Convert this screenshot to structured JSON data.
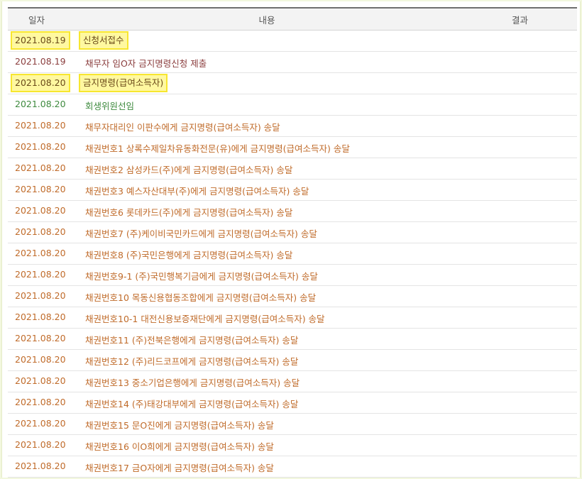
{
  "table": {
    "headers": {
      "date": "일자",
      "content": "내용",
      "result": "결과"
    },
    "rows": [
      {
        "date": "2021.08.19",
        "content": "신청서접수",
        "style": "hl"
      },
      {
        "date": "2021.08.19",
        "content": "채무자 임O자 금지명령신청 제출",
        "style": "c-dark"
      },
      {
        "date": "2021.08.20",
        "content": "금지명령(급여소득자)",
        "style": "hl"
      },
      {
        "date": "2021.08.20",
        "content": "회생위원선임",
        "style": "c-green"
      },
      {
        "date": "2021.08.20",
        "content": "채무자대리인 이판수에게 금지명령(급여소득자) 송달",
        "style": ""
      },
      {
        "date": "2021.08.20",
        "content": "채권번호1 상록수제일차유동화전문(유)에게 금지명령(급여소득자) 송달",
        "style": ""
      },
      {
        "date": "2021.08.20",
        "content": "채권번호2 삼성카드(주)에게 금지명령(급여소득자) 송달",
        "style": ""
      },
      {
        "date": "2021.08.20",
        "content": "채권번호3 예스자산대부(주)에게 금지명령(급여소득자) 송달",
        "style": ""
      },
      {
        "date": "2021.08.20",
        "content": "채권번호6 롯데카드(주)에게 금지명령(급여소득자) 송달",
        "style": ""
      },
      {
        "date": "2021.08.20",
        "content": "채권번호7 (주)케이비국민카드에게 금지명령(급여소득자) 송달",
        "style": ""
      },
      {
        "date": "2021.08.20",
        "content": "채권번호8 (주)국민은행에게 금지명령(급여소득자) 송달",
        "style": ""
      },
      {
        "date": "2021.08.20",
        "content": "채권번호9-1 (주)국민행복기금에게 금지명령(급여소득자) 송달",
        "style": ""
      },
      {
        "date": "2021.08.20",
        "content": "채권번호10 목동신용협동조합에게 금지명령(급여소득자) 송달",
        "style": ""
      },
      {
        "date": "2021.08.20",
        "content": "채권번호10-1 대전신용보증재단에게 금지명령(급여소득자) 송달",
        "style": ""
      },
      {
        "date": "2021.08.20",
        "content": "채권번호11 (주)전북은행에게 금지명령(급여소득자) 송달",
        "style": ""
      },
      {
        "date": "2021.08.20",
        "content": "채권번호12 (주)리드코프에게 금지명령(급여소득자) 송달",
        "style": ""
      },
      {
        "date": "2021.08.20",
        "content": "채권번호13 중소기업은행에게 금지명령(급여소득자) 송달",
        "style": ""
      },
      {
        "date": "2021.08.20",
        "content": "채권번호14 (주)태강대부에게 금지명령(급여소득자) 송달",
        "style": ""
      },
      {
        "date": "2021.08.20",
        "content": "채권번호15 문O진에게 금지명령(급여소득자) 송달",
        "style": ""
      },
      {
        "date": "2021.08.20",
        "content": "채권번호16 이O희에게 금지명령(급여소득자) 송달",
        "style": ""
      },
      {
        "date": "2021.08.20",
        "content": "채권번호17 금O자에게 금지명령(급여소득자) 송달",
        "style": ""
      }
    ]
  }
}
